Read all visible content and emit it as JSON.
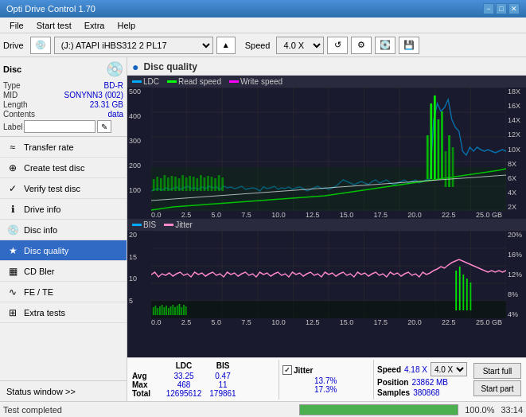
{
  "app": {
    "title": "Opti Drive Control 1.70",
    "min_btn": "−",
    "max_btn": "□",
    "close_btn": "✕"
  },
  "menu": {
    "items": [
      "File",
      "Start test",
      "Extra",
      "Help"
    ]
  },
  "drive_bar": {
    "label": "Drive",
    "drive_value": "(J:)  ATAPI iHBS312  2 PL17",
    "speed_label": "Speed",
    "speed_value": "4.0 X"
  },
  "disc": {
    "title": "Disc",
    "type_label": "Type",
    "type_value": "BD-R",
    "mid_label": "MID",
    "mid_value": "SONYNN3 (002)",
    "length_label": "Length",
    "length_value": "23.31 GB",
    "contents_label": "Contents",
    "contents_value": "data",
    "label_label": "Label",
    "label_value": ""
  },
  "nav": {
    "items": [
      {
        "id": "transfer-rate",
        "label": "Transfer rate",
        "icon": "≈"
      },
      {
        "id": "create-test-disc",
        "label": "Create test disc",
        "icon": "⊕"
      },
      {
        "id": "verify-test-disc",
        "label": "Verify test disc",
        "icon": "✓"
      },
      {
        "id": "drive-info",
        "label": "Drive info",
        "icon": "ℹ"
      },
      {
        "id": "disc-info",
        "label": "Disc info",
        "icon": "💿"
      },
      {
        "id": "disc-quality",
        "label": "Disc quality",
        "icon": "★",
        "active": true
      },
      {
        "id": "cd-bler",
        "label": "CD Bler",
        "icon": "▦"
      },
      {
        "id": "fe-te",
        "label": "FE / TE",
        "icon": "∿"
      },
      {
        "id": "extra-tests",
        "label": "Extra tests",
        "icon": "⊞"
      }
    ],
    "status_window": "Status window >>"
  },
  "chart": {
    "title": "Disc quality",
    "icon": "●",
    "legend_top": [
      {
        "label": "LDC",
        "color": "#00aaff"
      },
      {
        "label": "Read speed",
        "color": "#00ff00"
      },
      {
        "label": "Write speed",
        "color": "#ff00ff"
      }
    ],
    "legend_bottom": [
      {
        "label": "BIS",
        "color": "#00aaff"
      },
      {
        "label": "Jitter",
        "color": "#ff88cc"
      }
    ],
    "top_chart": {
      "y_left_max": 500,
      "y_right_labels": [
        "18X",
        "16X",
        "14X",
        "12X",
        "10X",
        "8X",
        "6X",
        "4X",
        "2X"
      ],
      "x_labels": [
        "0.0",
        "2.5",
        "5.0",
        "7.5",
        "10.0",
        "12.5",
        "15.0",
        "17.5",
        "20.0",
        "22.5",
        "25.0 GB"
      ]
    },
    "bottom_chart": {
      "y_left_max": 20,
      "y_right_labels": [
        "20%",
        "16%",
        "12%",
        "8%",
        "4%"
      ],
      "x_labels": [
        "0.0",
        "2.5",
        "5.0",
        "7.5",
        "10.0",
        "12.5",
        "15.0",
        "17.5",
        "20.0",
        "22.5",
        "25.0 GB"
      ]
    }
  },
  "stats": {
    "ldc_label": "LDC",
    "bis_label": "BIS",
    "jitter_label": "Jitter",
    "speed_label": "Speed",
    "jitter_checked": true,
    "avg_label": "Avg",
    "avg_ldc": "33.25",
    "avg_bis": "0.47",
    "avg_jitter": "13.7%",
    "avg_speed": "4.18 X",
    "max_label": "Max",
    "max_ldc": "468",
    "max_bis": "11",
    "max_jitter": "17.3%",
    "total_label": "Total",
    "total_ldc": "12695612",
    "total_bis": "179861",
    "position_label": "Position",
    "position_value": "23862 MB",
    "samples_label": "Samples",
    "samples_value": "380868",
    "speed_select": "4.0 X",
    "start_full_label": "Start full",
    "start_part_label": "Start part"
  },
  "progress": {
    "status_text": "Test completed",
    "percent": 100,
    "percent_label": "100.0%",
    "time": "33:14"
  }
}
